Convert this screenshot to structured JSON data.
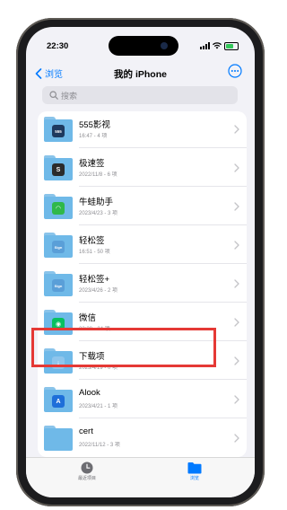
{
  "status_bar": {
    "time": "22:30",
    "battery_level": 0.7
  },
  "nav": {
    "back_label": "浏览",
    "title": "我的 iPhone",
    "more_icon": "ellipsis-circle-icon"
  },
  "search": {
    "placeholder": "搜索"
  },
  "files": [
    {
      "name": "555影视",
      "meta": "16:47 - 4 项",
      "icon": "555-app-icon",
      "color": "#1e3a5f",
      "glyph": "555"
    },
    {
      "name": "极速签",
      "meta": "2022/11/8 - 6 项",
      "icon": "speed-sign-app-icon",
      "color": "#2b2b2b",
      "glyph": "S"
    },
    {
      "name": "牛蛙助手",
      "meta": "2023/4/23 - 3 项",
      "icon": "frog-app-icon",
      "color": "#2fb84a",
      "glyph": "◠"
    },
    {
      "name": "轻松签",
      "meta": "16:51 - 50 项",
      "icon": "easy-sign-app-icon",
      "color": "#5a9fd8",
      "glyph": "Sign"
    },
    {
      "name": "轻松签+",
      "meta": "2023/4/26 - 2 项",
      "icon": "easy-sign-plus-app-icon",
      "color": "#5a9fd8",
      "glyph": "Sign"
    },
    {
      "name": "微信",
      "meta": "22:28 - 24 项",
      "icon": "wechat-app-icon",
      "color": "#07c160",
      "glyph": "◉"
    },
    {
      "name": "下载项",
      "meta": "2023/4/19 - 0 项",
      "icon": "download-icon",
      "color": "#8ec5ec",
      "glyph": "↓"
    },
    {
      "name": "Alook",
      "meta": "2023/4/21 - 1 项",
      "icon": "alook-app-icon",
      "color": "#1e6fd9",
      "glyph": "A"
    },
    {
      "name": "cert",
      "meta": "2022/11/12 - 3 项",
      "icon": "folder-icon",
      "color": "",
      "glyph": ""
    }
  ],
  "tabbar": {
    "recent_label": "最近项目",
    "browse_label": "浏览",
    "active_color": "#007aff"
  },
  "highlight_color": "#e53935"
}
